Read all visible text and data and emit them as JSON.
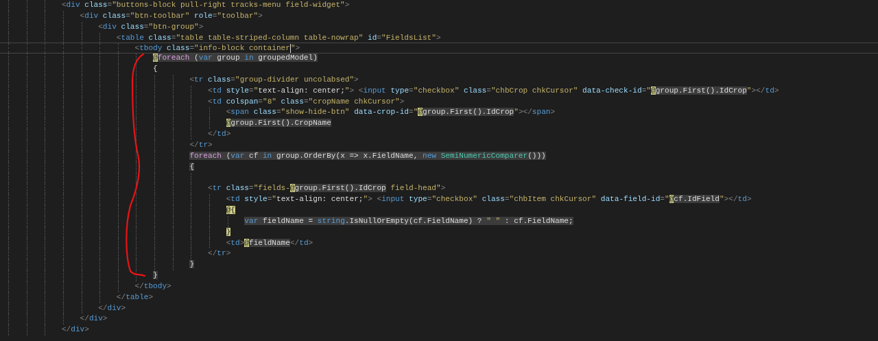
{
  "lines": [
    {
      "tokens": [
        {
          "kind": "p",
          "text": "<"
        },
        {
          "kind": "tag",
          "text": "div"
        },
        {
          "kind": "attr",
          "text": " class"
        },
        {
          "kind": "p",
          "text": "="
        },
        {
          "kind": "str",
          "text": "\"buttons-block pull-right tracks-menu field-widget\""
        },
        {
          "kind": "p",
          "text": ">"
        }
      ],
      "children": [
        {
          "tokens": [
            {
              "kind": "p",
              "text": "<"
            },
            {
              "kind": "tag",
              "text": "div"
            },
            {
              "kind": "attr",
              "text": " class"
            },
            {
              "kind": "p",
              "text": "="
            },
            {
              "kind": "str",
              "text": "\"btn-toolbar\""
            },
            {
              "kind": "attr",
              "text": " role"
            },
            {
              "kind": "p",
              "text": "="
            },
            {
              "kind": "str",
              "text": "\"toolbar\""
            },
            {
              "kind": "p",
              "text": ">"
            }
          ],
          "children": [
            {
              "tokens": [
                {
                  "kind": "p",
                  "text": "<"
                },
                {
                  "kind": "tag",
                  "text": "div"
                },
                {
                  "kind": "attr",
                  "text": " class"
                },
                {
                  "kind": "p",
                  "text": "="
                },
                {
                  "kind": "str",
                  "text": "\"btn-group\""
                },
                {
                  "kind": "p",
                  "text": ">"
                }
              ],
              "children": [
                {
                  "tokens": [
                    {
                      "kind": "p",
                      "text": "<"
                    },
                    {
                      "kind": "tag",
                      "text": "table"
                    },
                    {
                      "kind": "attr",
                      "text": " class"
                    },
                    {
                      "kind": "p",
                      "text": "="
                    },
                    {
                      "kind": "str",
                      "text": "\"table table-striped-column table-nowrap\""
                    },
                    {
                      "kind": "attr",
                      "text": " id"
                    },
                    {
                      "kind": "p",
                      "text": "="
                    },
                    {
                      "kind": "str",
                      "text": "\"FieldsList\""
                    },
                    {
                      "kind": "p",
                      "text": ">"
                    }
                  ],
                  "children": [
                    {
                      "current": true,
                      "tokens": [
                        {
                          "kind": "p",
                          "text": "<"
                        },
                        {
                          "kind": "tag",
                          "text": "tbody"
                        },
                        {
                          "kind": "attr",
                          "text": " class"
                        },
                        {
                          "kind": "p",
                          "text": "="
                        },
                        {
                          "kind": "str",
                          "text": "\"info-block container",
                          "caret": true
                        },
                        {
                          "kind": "str",
                          "text": "\""
                        },
                        {
                          "kind": "p",
                          "text": ">"
                        }
                      ],
                      "children": [
                        {
                          "tokens": [
                            {
                              "kind": "at",
                              "text": "@"
                            },
                            {
                              "kind": "kw",
                              "text": "foreach",
                              "shaded": true
                            },
                            {
                              "kind": "txt",
                              "text": " (",
                              "shaded": true
                            },
                            {
                              "kind": "kwb",
                              "text": "var",
                              "shaded": true
                            },
                            {
                              "kind": "txt",
                              "text": " group ",
                              "shaded": true
                            },
                            {
                              "kind": "kwb",
                              "text": "in",
                              "shaded": true
                            },
                            {
                              "kind": "txt",
                              "text": " groupedModel)",
                              "shaded": true
                            }
                          ]
                        },
                        {
                          "tokens": [
                            {
                              "kind": "txt",
                              "text": "{"
                            }
                          ],
                          "children": [
                            {
                              "children": [
                                {
                                  "tokens": [
                                    {
                                      "kind": "p",
                                      "text": "<"
                                    },
                                    {
                                      "kind": "tag",
                                      "text": "tr"
                                    },
                                    {
                                      "kind": "attr",
                                      "text": " class"
                                    },
                                    {
                                      "kind": "p",
                                      "text": "="
                                    },
                                    {
                                      "kind": "str",
                                      "text": "\"group-divider uncolabsed\""
                                    },
                                    {
                                      "kind": "p",
                                      "text": ">"
                                    }
                                  ],
                                  "children": [
                                    {
                                      "tokens": [
                                        {
                                          "kind": "p",
                                          "text": "<"
                                        },
                                        {
                                          "kind": "tag",
                                          "text": "td"
                                        },
                                        {
                                          "kind": "attr",
                                          "text": " style"
                                        },
                                        {
                                          "kind": "p",
                                          "text": "="
                                        },
                                        {
                                          "kind": "str",
                                          "text": "\""
                                        },
                                        {
                                          "kind": "txt",
                                          "text": "text-align: center;"
                                        },
                                        {
                                          "kind": "str",
                                          "text": "\""
                                        },
                                        {
                                          "kind": "p",
                                          "text": "> <"
                                        },
                                        {
                                          "kind": "tag",
                                          "text": "input"
                                        },
                                        {
                                          "kind": "attr",
                                          "text": " type"
                                        },
                                        {
                                          "kind": "p",
                                          "text": "="
                                        },
                                        {
                                          "kind": "str",
                                          "text": "\"checkbox\""
                                        },
                                        {
                                          "kind": "attr",
                                          "text": " class"
                                        },
                                        {
                                          "kind": "p",
                                          "text": "="
                                        },
                                        {
                                          "kind": "str",
                                          "text": "\"chbCrop chkCursor\""
                                        },
                                        {
                                          "kind": "attr",
                                          "text": " data-check-id"
                                        },
                                        {
                                          "kind": "p",
                                          "text": "="
                                        },
                                        {
                                          "kind": "str",
                                          "text": "\""
                                        },
                                        {
                                          "kind": "at",
                                          "text": "@"
                                        },
                                        {
                                          "kind": "txt",
                                          "text": "group.First().IdCrop",
                                          "shaded": true
                                        },
                                        {
                                          "kind": "str",
                                          "text": "\""
                                        },
                                        {
                                          "kind": "p",
                                          "text": "></"
                                        },
                                        {
                                          "kind": "tag",
                                          "text": "td"
                                        },
                                        {
                                          "kind": "p",
                                          "text": ">"
                                        }
                                      ]
                                    },
                                    {
                                      "tokens": [
                                        {
                                          "kind": "p",
                                          "text": "<"
                                        },
                                        {
                                          "kind": "tag",
                                          "text": "td"
                                        },
                                        {
                                          "kind": "attr",
                                          "text": " colspan"
                                        },
                                        {
                                          "kind": "p",
                                          "text": "="
                                        },
                                        {
                                          "kind": "str",
                                          "text": "\"8\""
                                        },
                                        {
                                          "kind": "attr",
                                          "text": " class"
                                        },
                                        {
                                          "kind": "p",
                                          "text": "="
                                        },
                                        {
                                          "kind": "str",
                                          "text": "\"cropName chkCursor\""
                                        },
                                        {
                                          "kind": "p",
                                          "text": ">"
                                        }
                                      ],
                                      "children": [
                                        {
                                          "tokens": [
                                            {
                                              "kind": "p",
                                              "text": "<"
                                            },
                                            {
                                              "kind": "tag",
                                              "text": "span"
                                            },
                                            {
                                              "kind": "attr",
                                              "text": " class"
                                            },
                                            {
                                              "kind": "p",
                                              "text": "="
                                            },
                                            {
                                              "kind": "str",
                                              "text": "\"show-hide-btn\""
                                            },
                                            {
                                              "kind": "attr",
                                              "text": " data-crop-id"
                                            },
                                            {
                                              "kind": "p",
                                              "text": "="
                                            },
                                            {
                                              "kind": "str",
                                              "text": "\""
                                            },
                                            {
                                              "kind": "at",
                                              "text": "@"
                                            },
                                            {
                                              "kind": "txt",
                                              "text": "group.First().IdCrop",
                                              "shaded": true
                                            },
                                            {
                                              "kind": "str",
                                              "text": "\""
                                            },
                                            {
                                              "kind": "p",
                                              "text": "></"
                                            },
                                            {
                                              "kind": "tag",
                                              "text": "span"
                                            },
                                            {
                                              "kind": "p",
                                              "text": ">"
                                            }
                                          ]
                                        },
                                        {
                                          "tokens": [
                                            {
                                              "kind": "at",
                                              "text": "@"
                                            },
                                            {
                                              "kind": "txt",
                                              "text": "group.First().CropName",
                                              "shaded": true
                                            }
                                          ]
                                        }
                                      ]
                                    },
                                    {
                                      "tokens": [
                                        {
                                          "kind": "p",
                                          "text": "</"
                                        },
                                        {
                                          "kind": "tag",
                                          "text": "td"
                                        },
                                        {
                                          "kind": "p",
                                          "text": ">"
                                        }
                                      ]
                                    }
                                  ]
                                },
                                {
                                  "tokens": [
                                    {
                                      "kind": "p",
                                      "text": "</"
                                    },
                                    {
                                      "kind": "tag",
                                      "text": "tr"
                                    },
                                    {
                                      "kind": "p",
                                      "text": ">"
                                    }
                                  ]
                                },
                                {
                                  "tokens": [
                                    {
                                      "kind": "kw",
                                      "text": "foreach",
                                      "shaded": true
                                    },
                                    {
                                      "kind": "txt",
                                      "text": " (",
                                      "shaded": true
                                    },
                                    {
                                      "kind": "kwb",
                                      "text": "var",
                                      "shaded": true
                                    },
                                    {
                                      "kind": "txt",
                                      "text": " cf ",
                                      "shaded": true
                                    },
                                    {
                                      "kind": "kwb",
                                      "text": "in",
                                      "shaded": true
                                    },
                                    {
                                      "kind": "txt",
                                      "text": " group.OrderBy(x => x.FieldName, ",
                                      "shaded": true
                                    },
                                    {
                                      "kind": "kwb",
                                      "text": "new ",
                                      "shaded": true
                                    },
                                    {
                                      "kind": "type",
                                      "text": "SemiNumericComparer",
                                      "shaded": true
                                    },
                                    {
                                      "kind": "txt",
                                      "text": "()))",
                                      "shaded": true
                                    }
                                  ]
                                },
                                {
                                  "tokens": [
                                    {
                                      "kind": "txt",
                                      "text": "{",
                                      "shaded": true
                                    }
                                  ],
                                  "children": [
                                    {
                                      "blank": true
                                    },
                                    {
                                      "tokens": [
                                        {
                                          "kind": "p",
                                          "text": "<"
                                        },
                                        {
                                          "kind": "tag",
                                          "text": "tr"
                                        },
                                        {
                                          "kind": "attr",
                                          "text": " class"
                                        },
                                        {
                                          "kind": "p",
                                          "text": "="
                                        },
                                        {
                                          "kind": "str",
                                          "text": "\"fields-"
                                        },
                                        {
                                          "kind": "at",
                                          "text": "@"
                                        },
                                        {
                                          "kind": "txt",
                                          "text": "group.First().IdCrop",
                                          "shaded": true
                                        },
                                        {
                                          "kind": "str",
                                          "text": " field-head\""
                                        },
                                        {
                                          "kind": "p",
                                          "text": ">"
                                        }
                                      ],
                                      "children": [
                                        {
                                          "tokens": [
                                            {
                                              "kind": "p",
                                              "text": "<"
                                            },
                                            {
                                              "kind": "tag",
                                              "text": "td"
                                            },
                                            {
                                              "kind": "attr",
                                              "text": " style"
                                            },
                                            {
                                              "kind": "p",
                                              "text": "="
                                            },
                                            {
                                              "kind": "str",
                                              "text": "\""
                                            },
                                            {
                                              "kind": "txt",
                                              "text": "text-align: center;"
                                            },
                                            {
                                              "kind": "str",
                                              "text": "\""
                                            },
                                            {
                                              "kind": "p",
                                              "text": "> <"
                                            },
                                            {
                                              "kind": "tag",
                                              "text": "input"
                                            },
                                            {
                                              "kind": "attr",
                                              "text": " type"
                                            },
                                            {
                                              "kind": "p",
                                              "text": "="
                                            },
                                            {
                                              "kind": "str",
                                              "text": "\"checkbox\""
                                            },
                                            {
                                              "kind": "attr",
                                              "text": " class"
                                            },
                                            {
                                              "kind": "p",
                                              "text": "="
                                            },
                                            {
                                              "kind": "str",
                                              "text": "\"chbItem chkCursor\""
                                            },
                                            {
                                              "kind": "attr",
                                              "text": " data-field-id"
                                            },
                                            {
                                              "kind": "p",
                                              "text": "="
                                            },
                                            {
                                              "kind": "str",
                                              "text": "\""
                                            },
                                            {
                                              "kind": "at",
                                              "text": "@"
                                            },
                                            {
                                              "kind": "txt",
                                              "text": "cf.IdField",
                                              "shaded": true
                                            },
                                            {
                                              "kind": "str",
                                              "text": "\""
                                            },
                                            {
                                              "kind": "p",
                                              "text": "></"
                                            },
                                            {
                                              "kind": "tag",
                                              "text": "td"
                                            },
                                            {
                                              "kind": "p",
                                              "text": ">"
                                            }
                                          ]
                                        },
                                        {
                                          "tokens": [
                                            {
                                              "kind": "at",
                                              "text": "@{"
                                            }
                                          ],
                                          "children": [
                                            {
                                              "tokens": [
                                                {
                                                  "kind": "kwb",
                                                  "text": "var",
                                                  "shaded": true
                                                },
                                                {
                                                  "kind": "txt",
                                                  "text": " fieldName = ",
                                                  "shaded": true
                                                },
                                                {
                                                  "kind": "kwb",
                                                  "text": "string",
                                                  "shaded": true
                                                },
                                                {
                                                  "kind": "txt",
                                                  "text": ".IsNullOrEmpty(cf.FieldName) ? ",
                                                  "shaded": true
                                                },
                                                {
                                                  "kind": "str",
                                                  "text": "\" \"",
                                                  "shaded": true
                                                },
                                                {
                                                  "kind": "txt",
                                                  "text": " : cf.FieldName;",
                                                  "shaded": true
                                                }
                                              ]
                                            }
                                          ]
                                        },
                                        {
                                          "tokens": [
                                            {
                                              "kind": "at",
                                              "text": "}"
                                            }
                                          ]
                                        },
                                        {
                                          "tokens": [
                                            {
                                              "kind": "p",
                                              "text": "<"
                                            },
                                            {
                                              "kind": "tag",
                                              "text": "td"
                                            },
                                            {
                                              "kind": "p",
                                              "text": ">"
                                            },
                                            {
                                              "kind": "at",
                                              "text": "@"
                                            },
                                            {
                                              "kind": "txt",
                                              "text": "fieldName",
                                              "shaded": true
                                            },
                                            {
                                              "kind": "p",
                                              "text": "</"
                                            },
                                            {
                                              "kind": "tag",
                                              "text": "td"
                                            },
                                            {
                                              "kind": "p",
                                              "text": ">"
                                            }
                                          ]
                                        }
                                      ]
                                    },
                                    {
                                      "tokens": [
                                        {
                                          "kind": "p",
                                          "text": "</"
                                        },
                                        {
                                          "kind": "tag",
                                          "text": "tr"
                                        },
                                        {
                                          "kind": "p",
                                          "text": ">"
                                        }
                                      ]
                                    }
                                  ]
                                },
                                {
                                  "tokens": [
                                    {
                                      "kind": "txt",
                                      "text": "}",
                                      "shaded": true
                                    }
                                  ]
                                }
                              ]
                            }
                          ]
                        },
                        {
                          "tokens": [
                            {
                              "kind": "txt",
                              "text": "}",
                              "shaded": true
                            }
                          ]
                        }
                      ]
                    },
                    {
                      "tokens": [
                        {
                          "kind": "p",
                          "text": "</"
                        },
                        {
                          "kind": "tag",
                          "text": "tbody"
                        },
                        {
                          "kind": "p",
                          "text": ">"
                        }
                      ]
                    }
                  ]
                },
                {
                  "tokens": [
                    {
                      "kind": "p",
                      "text": "</"
                    },
                    {
                      "kind": "tag",
                      "text": "table"
                    },
                    {
                      "kind": "p",
                      "text": ">"
                    }
                  ]
                }
              ]
            },
            {
              "tokens": [
                {
                  "kind": "p",
                  "text": "</"
                },
                {
                  "kind": "tag",
                  "text": "div"
                },
                {
                  "kind": "p",
                  "text": ">"
                }
              ]
            }
          ]
        },
        {
          "tokens": [
            {
              "kind": "p",
              "text": "</"
            },
            {
              "kind": "tag",
              "text": "div"
            },
            {
              "kind": "p",
              "text": ">"
            }
          ]
        }
      ]
    },
    {
      "tokens": [
        {
          "kind": "p",
          "text": "</"
        },
        {
          "kind": "tag",
          "text": "div"
        },
        {
          "kind": "p",
          "text": ">"
        }
      ]
    }
  ]
}
